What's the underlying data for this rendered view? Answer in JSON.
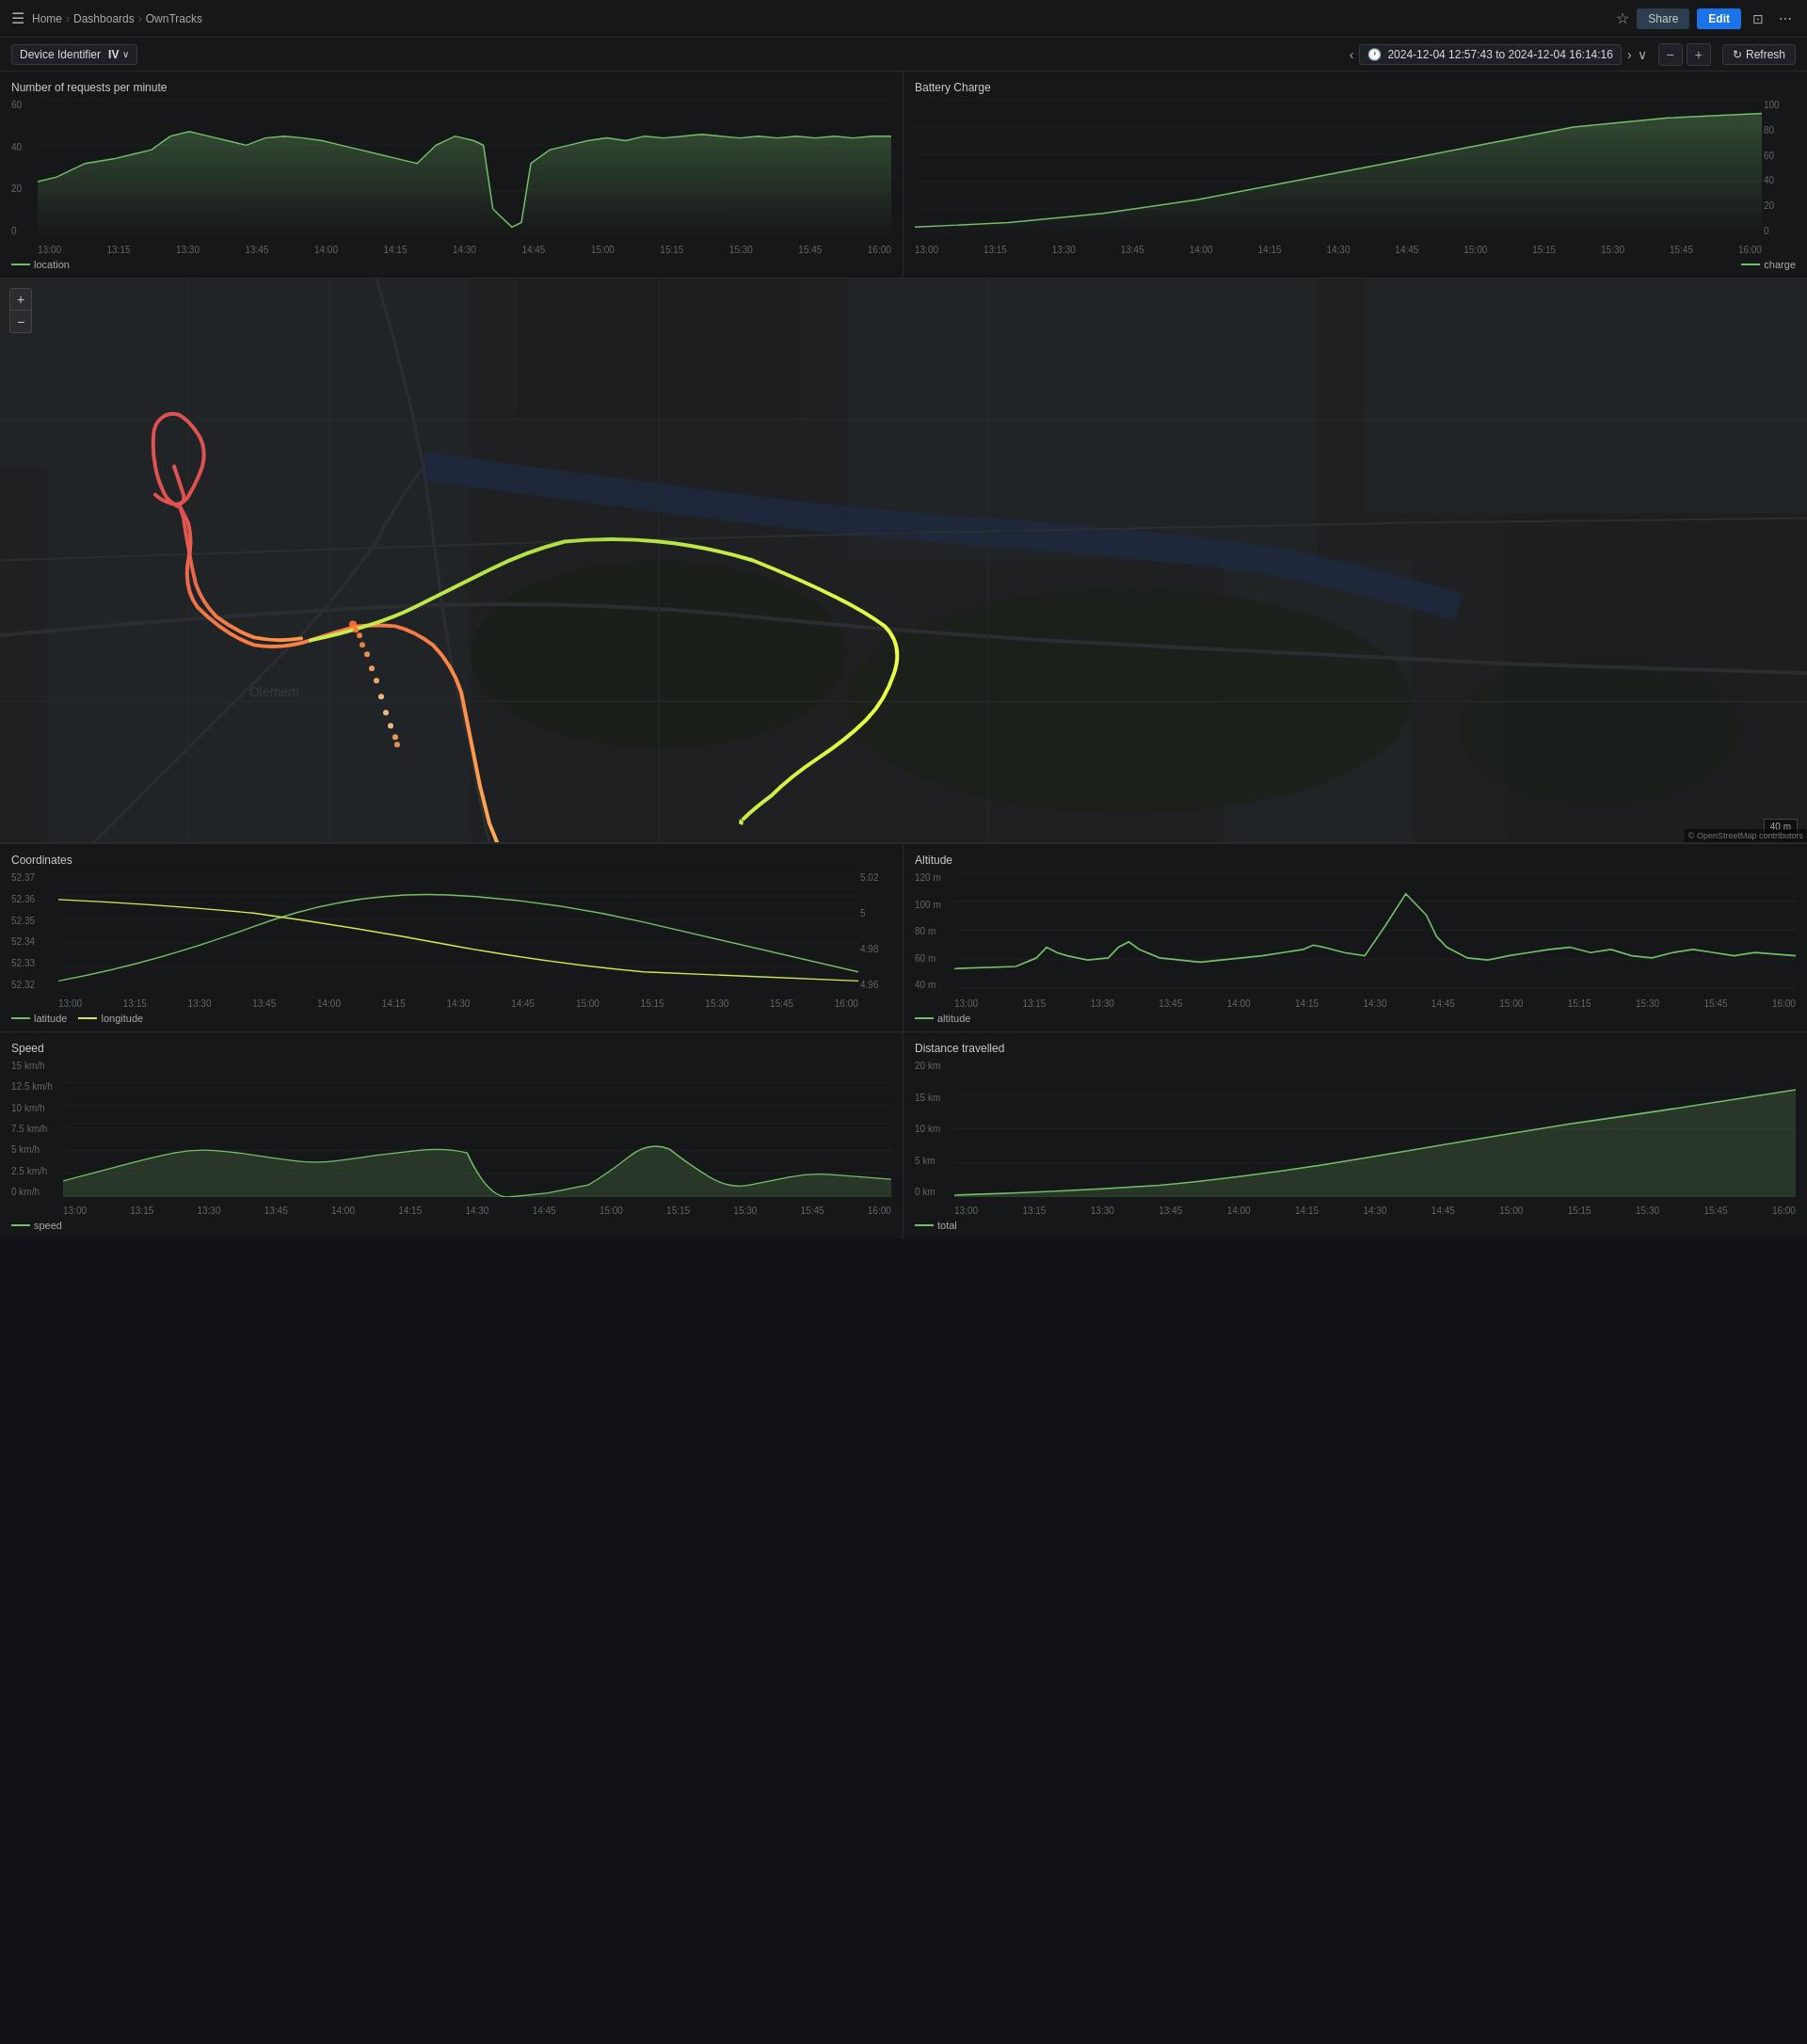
{
  "topbar": {
    "hamburger_icon": "≡",
    "breadcrumbs": [
      {
        "label": "Home",
        "sep": "›"
      },
      {
        "label": "Dashboards",
        "sep": "›"
      },
      {
        "label": "OwnTracks"
      }
    ],
    "star_icon": "☆",
    "share_label": "Share",
    "edit_label": "Edit",
    "tv_icon": "⊡",
    "dots_icon": "⋯"
  },
  "toolbar": {
    "device_label": "Device Identifier",
    "device_value": "IV",
    "device_dropdown_icon": "∨",
    "nav_left_icon": "‹",
    "clock_icon": "🕐",
    "time_range": "2024-12-04 12:57:43 to 2024-12-04 16:14:16",
    "nav_right_icon": "›",
    "dropdown_icon": "∨",
    "zoom_out_icon": "−",
    "zoom_in_icon": "+",
    "refresh_icon": "↻",
    "refresh_label": "Refresh"
  },
  "charts": {
    "requests_per_minute": {
      "title": "Number of requests per minute",
      "y_labels": [
        "60",
        "40",
        "20",
        "0"
      ],
      "x_labels": [
        "13:00",
        "13:15",
        "13:30",
        "13:45",
        "14:00",
        "14:15",
        "14:30",
        "14:45",
        "15:00",
        "15:15",
        "15:30",
        "15:45",
        "16:00"
      ],
      "legend": [
        {
          "label": "location",
          "color": "#73bf69"
        }
      ]
    },
    "battery_charge": {
      "title": "Battery Charge",
      "y_labels_left": [],
      "y_labels_right": [
        "100",
        "80",
        "60",
        "40",
        "20",
        "0"
      ],
      "x_labels": [
        "13:00",
        "13:15",
        "13:30",
        "13:45",
        "14:00",
        "14:15",
        "14:30",
        "14:45",
        "15:00",
        "15:15",
        "15:30",
        "15:45",
        "16:00"
      ],
      "legend": [
        {
          "label": "charge",
          "color": "#73bf69"
        }
      ]
    },
    "coordinates": {
      "title": "Coordinates",
      "y_labels_left": [
        "52.37",
        "52.36",
        "52.35",
        "52.34",
        "52.33",
        "52.32"
      ],
      "y_labels_right": [
        "5.02",
        "5",
        "4.98",
        "4.96"
      ],
      "x_labels": [
        "13:00",
        "13:15",
        "13:30",
        "13:45",
        "14:00",
        "14:15",
        "14:30",
        "14:45",
        "15:00",
        "15:15",
        "15:30",
        "15:45",
        "16:00"
      ],
      "legend": [
        {
          "label": "latitude",
          "color": "#73bf69"
        },
        {
          "label": "longitude",
          "color": "#caee4e"
        }
      ]
    },
    "altitude": {
      "title": "Altitude",
      "y_labels": [
        "120 m",
        "100 m",
        "80 m",
        "60 m",
        "40 m"
      ],
      "x_labels": [
        "13:00",
        "13:15",
        "13:30",
        "13:45",
        "14:00",
        "14:15",
        "14:30",
        "14:45",
        "15:00",
        "15:15",
        "15:30",
        "15:45",
        "16:00"
      ],
      "legend": [
        {
          "label": "altitude",
          "color": "#73bf69"
        }
      ]
    },
    "speed": {
      "title": "Speed",
      "y_labels": [
        "15 km/h",
        "12.5 km/h",
        "10 km/h",
        "7.5 km/h",
        "5 km/h",
        "2.5 km/h",
        "0 km/h"
      ],
      "x_labels": [
        "13:00",
        "13:15",
        "13:30",
        "13:45",
        "14:00",
        "14:15",
        "14:30",
        "14:45",
        "15:00",
        "15:15",
        "15:30",
        "15:45",
        "16:00"
      ],
      "legend": [
        {
          "label": "speed",
          "color": "#73bf69"
        }
      ]
    },
    "distance_travelled": {
      "title": "Distance travelled",
      "y_labels": [
        "20 km",
        "15 km",
        "10 km",
        "5 km",
        "0 km"
      ],
      "x_labels": [
        "13:00",
        "13:15",
        "13:30",
        "13:45",
        "14:00",
        "14:15",
        "14:30",
        "14:45",
        "15:00",
        "15:15",
        "15:30",
        "15:45",
        "16:00"
      ],
      "legend": [
        {
          "label": "total",
          "color": "#73bf69"
        }
      ]
    }
  },
  "map": {
    "zoom_in_label": "+",
    "zoom_out_label": "−",
    "scale_label": "40 m",
    "attribution": "© OpenStreetMap contributors"
  },
  "colors": {
    "accent_green": "#73bf69",
    "accent_yellow": "#caee4e",
    "nav_bg": "#161719",
    "panel_bg": "#161719",
    "edit_btn": "#1a73e8",
    "border": "#2a2a2a"
  }
}
